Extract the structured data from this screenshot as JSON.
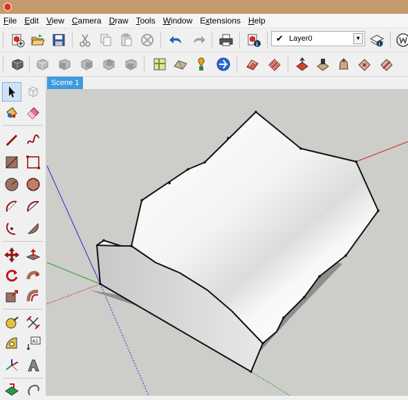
{
  "menu": {
    "items": [
      {
        "label": "File",
        "mnemonic": "F",
        "rest": "ile"
      },
      {
        "label": "Edit",
        "mnemonic": "E",
        "rest": "dit"
      },
      {
        "label": "View",
        "mnemonic": "V",
        "rest": "iew"
      },
      {
        "label": "Camera",
        "mnemonic": "C",
        "rest": "amera"
      },
      {
        "label": "Draw",
        "mnemonic": "D",
        "rest": "raw"
      },
      {
        "label": "Tools",
        "mnemonic": "T",
        "rest": "ools"
      },
      {
        "label": "Window",
        "mnemonic": "W",
        "rest": "indow"
      },
      {
        "label": "Extensions",
        "mnemonic": "x",
        "pre": "E",
        "rest": "tensions"
      },
      {
        "label": "Help",
        "mnemonic": "H",
        "rest": "elp"
      }
    ]
  },
  "layer": {
    "name": "Layer0",
    "check": "✔"
  },
  "scenes": {
    "tabs": [
      "Scene 1"
    ]
  },
  "colors": {
    "titlebar": "#c49a6c",
    "scene_tab": "#3c9ce0",
    "viewport_bg": "#cdcdc9",
    "axis_red": "#d02020",
    "axis_green": "#20a020",
    "axis_blue": "#2030d0"
  },
  "icons": {
    "toolbar_main": [
      "new-icon",
      "open-icon",
      "save-icon",
      "cut-icon",
      "copy-icon",
      "paste-icon",
      "erase-icon",
      "undo-icon",
      "redo-icon",
      "print-icon",
      "model-info-icon"
    ],
    "toolbar_views": [
      "iso-view-icon",
      "top-view-icon",
      "front-view-icon",
      "right-view-icon",
      "back-view-icon",
      "left-view-icon",
      "map-location-icon",
      "terrain-icon",
      "add-location-icon",
      "geo-toggle-icon",
      "sandbox-from-contours-icon",
      "sandbox-from-scratch-icon",
      "smoove-icon",
      "stamp-icon",
      "drape-icon",
      "add-detail-icon",
      "flip-edge-icon"
    ],
    "left_tools": [
      "select-icon",
      "component-icon",
      "paint-bucket-icon",
      "eraser-icon",
      "line-icon",
      "freehand-icon",
      "rectangle-icon",
      "rotated-rectangle-icon",
      "circle-icon",
      "polygon-icon",
      "arc-icon",
      "two-point-arc-icon",
      "three-point-arc-icon",
      "pie-icon",
      "move-icon",
      "push-pull-icon",
      "rotate-icon",
      "follow-me-icon",
      "scale-icon",
      "offset-icon",
      "tape-measure-icon",
      "dimension-icon",
      "protractor-icon",
      "text-icon",
      "axes-icon",
      "3d-text-icon",
      "section-plane-icon",
      "orbit-icon"
    ]
  }
}
